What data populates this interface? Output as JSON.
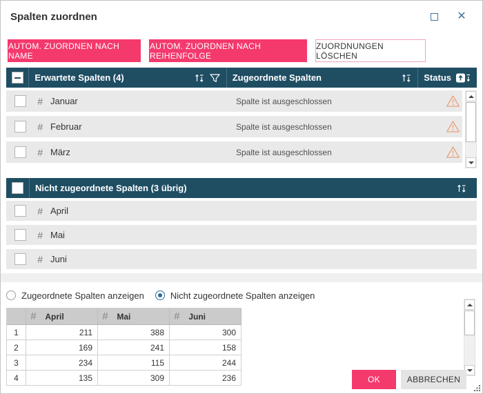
{
  "dialog": {
    "title": "Spalten zuordnen"
  },
  "toolbar": {
    "auto_map_by_name": "AUTOM. ZUORDNEN NACH NAME",
    "auto_map_by_order": "AUTOM. ZUORDNEN NACH REIHENFOLGE",
    "clear_mappings": "ZUORDNUNGEN LÖSCHEN"
  },
  "expected_table": {
    "col_expected": "Erwartete Spalten (4)",
    "col_mapped": "Zugeordnete Spalten",
    "col_status": "Status",
    "hash_glyph": "#",
    "rows": [
      {
        "name": "Januar",
        "mapped": "Spalte ist ausgeschlossen"
      },
      {
        "name": "Februar",
        "mapped": "Spalte ist ausgeschlossen"
      },
      {
        "name": "März",
        "mapped": "Spalte ist ausgeschlossen"
      }
    ]
  },
  "unmapped_table": {
    "header": "Nicht zugeordnete Spalten (3 übrig)",
    "hash_glyph": "#",
    "rows": [
      {
        "name": "April"
      },
      {
        "name": "Mai"
      },
      {
        "name": "Juni"
      }
    ]
  },
  "radios": {
    "mapped_label": "Zugeordnete Spalten anzeigen",
    "unmapped_label": "Nicht zugeordnete Spalten anzeigen",
    "selected": "unmapped"
  },
  "preview": {
    "hash_glyph": "#",
    "columns": [
      "April",
      "Mai",
      "Juni"
    ],
    "rows": [
      {
        "num": "1",
        "values": [
          "211",
          "388",
          "300"
        ]
      },
      {
        "num": "2",
        "values": [
          "169",
          "241",
          "158"
        ]
      },
      {
        "num": "3",
        "values": [
          "234",
          "115",
          "244"
        ]
      },
      {
        "num": "4",
        "values": [
          "135",
          "309",
          "236"
        ]
      }
    ]
  },
  "footer": {
    "ok": "OK",
    "cancel": "ABBRECHEN"
  },
  "colors": {
    "accent_pink": "#f4396d",
    "header_navy": "#1f4e63",
    "warning_orange": "#e8a277",
    "icon_blue": "#47729b",
    "radio_blue": "#2d6a9a"
  }
}
